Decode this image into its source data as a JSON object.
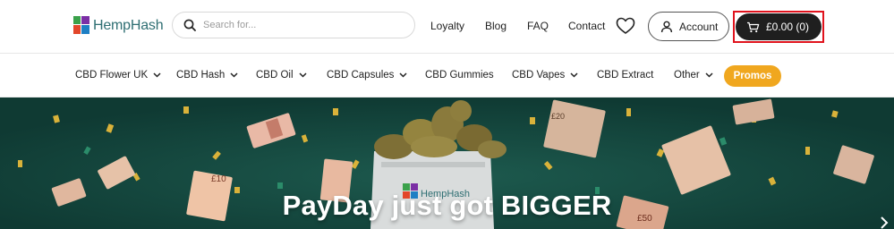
{
  "header": {
    "logo_text": "HempHash",
    "search_placeholder": "Search for...",
    "links": [
      "Loyalty",
      "Blog",
      "FAQ",
      "Contact"
    ],
    "account_label": "Account",
    "cart_label": "£0.00 (0)"
  },
  "nav": {
    "items": [
      "CBD Flower UK",
      "CBD Hash",
      "CBD Oil",
      "CBD Capsules",
      "CBD Gummies",
      "CBD Vapes",
      "CBD Extract",
      "Other"
    ],
    "promos_label": "Promos"
  },
  "hero": {
    "title": "PayDay just got BIGGER",
    "banknote_labels": [
      "£10",
      "£20",
      "£50"
    ],
    "bag_logo_text": "HempHash"
  },
  "colors": {
    "brand_teal": "#2f6f73",
    "cart_bg": "#1f1f1f",
    "highlight_red": "#e0131d",
    "promos_orange": "#f0a71f",
    "hero_green": "#12423a"
  },
  "icons": [
    "search-icon",
    "heart-icon",
    "user-icon",
    "cart-icon",
    "chevron-down-icon",
    "chevron-right-icon"
  ]
}
